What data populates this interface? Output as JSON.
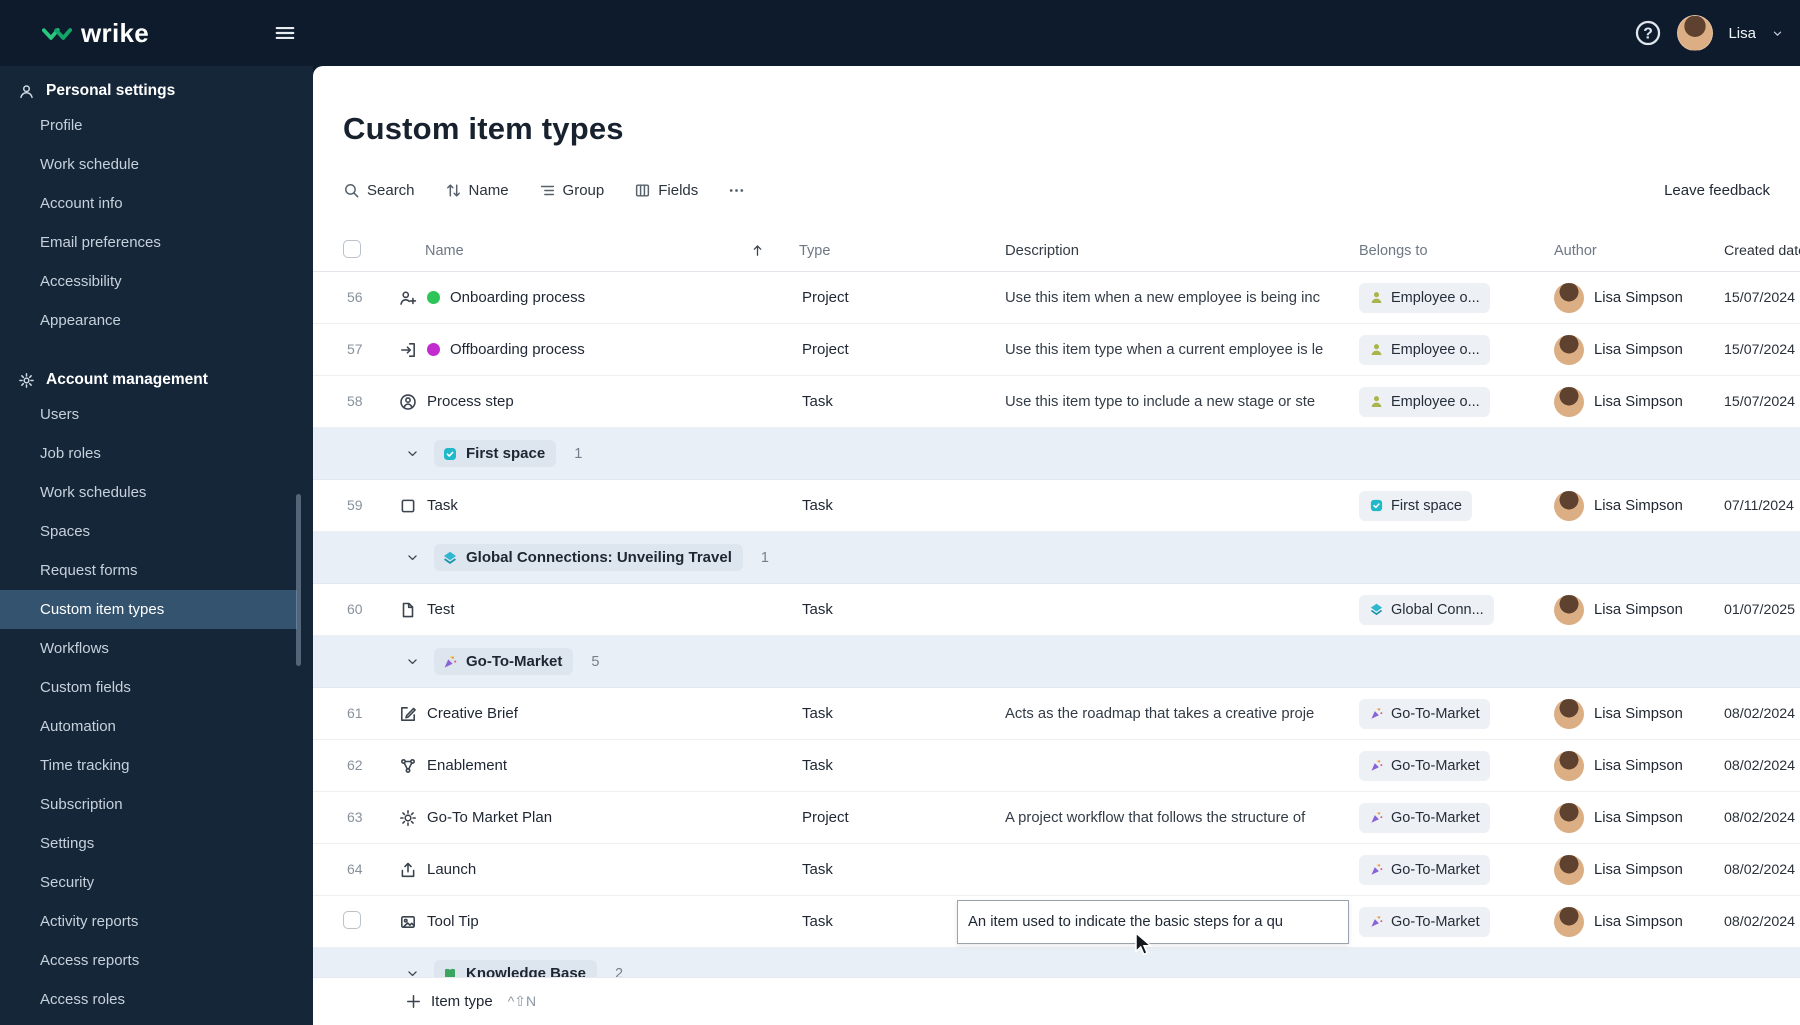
{
  "brand": {
    "logo_text": "wrike"
  },
  "topbar": {
    "user_name": "Lisa"
  },
  "sidebar": {
    "selected": "Custom item types",
    "sections": [
      {
        "title": "Personal settings",
        "icon": "person-icon",
        "items": [
          "Profile",
          "Work schedule",
          "Account info",
          "Email preferences",
          "Accessibility",
          "Appearance"
        ]
      },
      {
        "title": "Account management",
        "icon": "gear-icon",
        "items": [
          "Users",
          "Job roles",
          "Work schedules",
          "Spaces",
          "Request forms",
          "Custom item types",
          "Workflows",
          "Custom fields",
          "Automation",
          "Time tracking",
          "Subscription",
          "Settings",
          "Security",
          "Activity reports",
          "Access reports",
          "Access roles"
        ]
      }
    ]
  },
  "main": {
    "title": "Custom item types",
    "toolbar": {
      "search": "Search",
      "sort": "Name",
      "group": "Group",
      "fields": "Fields",
      "leave_feedback": "Leave feedback"
    },
    "table": {
      "columns": [
        "Name",
        "Type",
        "Description",
        "Belongs to",
        "Author",
        "Created date"
      ],
      "rows": [
        {
          "kind": "item",
          "num": "56",
          "icon": "person-plus-icon",
          "dot": "#2ec558",
          "name": "Onboarding process",
          "type": "Project",
          "description": "Use this item when a new employee is being inc",
          "belongs": {
            "icon": "employee-icon",
            "label": "Employee o..."
          },
          "author": "Lisa Simpson",
          "date": "15/07/2024"
        },
        {
          "kind": "item",
          "num": "57",
          "icon": "exit-icon",
          "dot": "#c32bd1",
          "name": "Offboarding process",
          "type": "Project",
          "description": "Use this item type when a current employee is le",
          "belongs": {
            "icon": "employee-icon",
            "label": "Employee o..."
          },
          "author": "Lisa Simpson",
          "date": "15/07/2024"
        },
        {
          "kind": "item",
          "num": "58",
          "icon": "person-circle-icon",
          "name": "Process step",
          "type": "Task",
          "description": "Use this item type to include a new stage or ste",
          "belongs": {
            "icon": "employee-icon",
            "label": "Employee o..."
          },
          "author": "Lisa Simpson",
          "date": "15/07/2024"
        },
        {
          "kind": "group",
          "icon": "first-space-icon",
          "label": "First space",
          "count": "1"
        },
        {
          "kind": "item",
          "num": "59",
          "icon": "square-icon",
          "name": "Task",
          "type": "Task",
          "description": "",
          "belongs": {
            "icon": "first-space-icon",
            "label": "First space"
          },
          "author": "Lisa Simpson",
          "date": "07/11/2024"
        },
        {
          "kind": "group",
          "icon": "global-space-icon",
          "label": "Global Connections: Unveiling Travel",
          "count": "1"
        },
        {
          "kind": "item",
          "num": "60",
          "icon": "file-icon",
          "name": "Test",
          "type": "Task",
          "description": "",
          "belongs": {
            "icon": "global-space-icon",
            "label": "Global Conn..."
          },
          "author": "Lisa Simpson",
          "date": "01/07/2025"
        },
        {
          "kind": "group",
          "icon": "gtm-space-icon",
          "label": "Go-To-Market",
          "count": "5"
        },
        {
          "kind": "item",
          "num": "61",
          "icon": "edit-icon",
          "name": "Creative Brief",
          "type": "Task",
          "description": "Acts as the roadmap that takes a creative proje",
          "belongs": {
            "icon": "gtm-space-icon",
            "label": "Go-To-Market"
          },
          "author": "Lisa Simpson",
          "date": "08/02/2024"
        },
        {
          "kind": "item",
          "num": "62",
          "icon": "flow-icon",
          "name": "Enablement",
          "type": "Task",
          "description": "",
          "belongs": {
            "icon": "gtm-space-icon",
            "label": "Go-To-Market"
          },
          "author": "Lisa Simpson",
          "date": "08/02/2024"
        },
        {
          "kind": "item",
          "num": "63",
          "icon": "sun-icon",
          "name": "Go-To Market Plan",
          "type": "Project",
          "description": "A project workflow that follows the structure of",
          "belongs": {
            "icon": "gtm-space-icon",
            "label": "Go-To-Market"
          },
          "author": "Lisa Simpson",
          "date": "08/02/2024"
        },
        {
          "kind": "item",
          "num": "64",
          "icon": "launch-icon",
          "name": "Launch",
          "type": "Task",
          "description": "",
          "belongs": {
            "icon": "gtm-space-icon",
            "label": "Go-To-Market"
          },
          "author": "Lisa Simpson",
          "date": "08/02/2024"
        },
        {
          "kind": "item",
          "num": "",
          "icon": "image-icon",
          "name": "Tool Tip",
          "type": "Task",
          "description": "An item used to indicate the basic steps for a qu",
          "belongs": {
            "icon": "gtm-space-icon",
            "label": "Go-To-Market"
          },
          "author": "Lisa Simpson",
          "date": "08/02/2024",
          "editing": true
        },
        {
          "kind": "group",
          "icon": "knowledge-base-icon",
          "label": "Knowledge Base",
          "count": "2",
          "partial": true
        }
      ]
    },
    "footer": {
      "add_label": "Item type",
      "shortcut": "^⇧N"
    }
  },
  "colors": {
    "accent_green": "#24c38a",
    "sidebar_selected": "#33536f",
    "group_row_bg": "#e9eff6"
  }
}
